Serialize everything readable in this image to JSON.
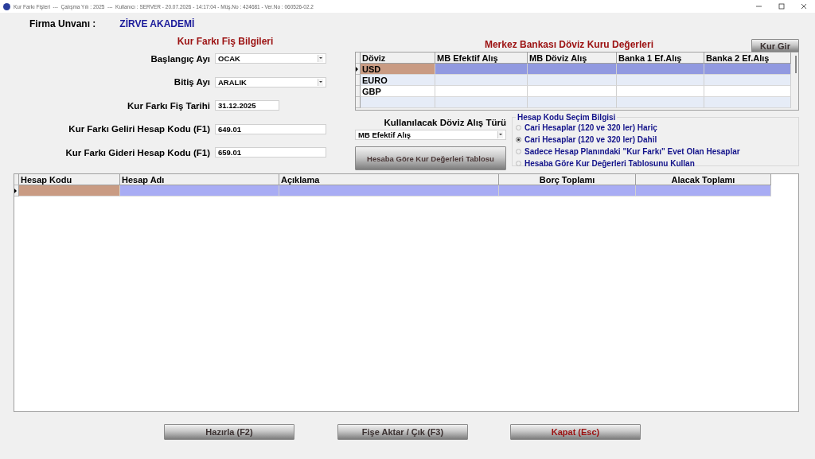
{
  "window": {
    "title": "Kur Farkı Fişleri  ---  Çalışma Yılı : 2025  ---  Kullanıcı : SERVER - 20.07.2026 - 14:17:04 - Müş.No : 424681 - Ver.No : 060526-02.2"
  },
  "company": {
    "label": "Firma Unvanı :",
    "value": "ZİRVE AKADEMİ"
  },
  "voucher_info": {
    "title": "Kur Farkı Fiş Bilgileri",
    "fields": [
      {
        "kind": "combo",
        "label": "Başlangıç Ayı",
        "value": "OCAK"
      },
      {
        "kind": "combo",
        "label": "Bitiş Ayı",
        "value": "ARALIK"
      },
      {
        "kind": "date",
        "label": "Kur Farkı Fiş Tarihi",
        "value": "31.12.2025"
      },
      {
        "kind": "text",
        "label": "Kur Farkı Geliri Hesap Kodu (F1)",
        "value": "649.01"
      },
      {
        "kind": "text",
        "label": "Kur Farkı Gideri Hesap Kodu (F1)",
        "value": "659.01"
      }
    ]
  },
  "rates": {
    "title": "Merkez Bankası Döviz Kuru Değerleri",
    "button": "Kur Gir",
    "columns": [
      "Döviz",
      "MB Efektif Alış",
      "MB Döviz Alış",
      "Banka 1 Ef.Alış",
      "Banka 2 Ef.Alış"
    ],
    "rows": [
      {
        "cells": [
          "USD"
        ],
        "selected": true
      },
      {
        "cells": [
          "EURO"
        ],
        "selected": false
      },
      {
        "cells": [
          "GBP"
        ],
        "selected": false
      }
    ]
  },
  "rate_type": {
    "label": "Kullanılacak Döviz Alış Türü",
    "value": "MB Efektif Alış",
    "button": "Hesaba Göre Kur Değerleri Tablosu"
  },
  "account_selection": {
    "title": "Hesap Kodu Seçim Bilgisi",
    "options": [
      {
        "label": "Cari Hesaplar (120 ve 320 ler) Hariç",
        "selected": false
      },
      {
        "label": "Cari Hesaplar (120 ve 320 ler) Dahil",
        "selected": true
      },
      {
        "label": "Sadece Hesap Planındaki \"Kur Farkı\" Evet Olan Hesaplar",
        "selected": false
      },
      {
        "label": "Hesaba Göre Kur Değerleri Tablosunu Kullan",
        "selected": false
      }
    ]
  },
  "table": {
    "columns": [
      "Hesap Kodu",
      "Hesap Adı",
      "Açıklama",
      "Borç Toplamı",
      "Alacak Toplamı"
    ],
    "rows": [
      {
        "selected": true
      }
    ]
  },
  "buttons": [
    {
      "label": "Hazırla (F2)",
      "kind": "normal"
    },
    {
      "label": "Fişe Aktar / Çık (F3)",
      "kind": "normal"
    },
    {
      "label": "Kapat (Esc)",
      "kind": "danger"
    }
  ]
}
